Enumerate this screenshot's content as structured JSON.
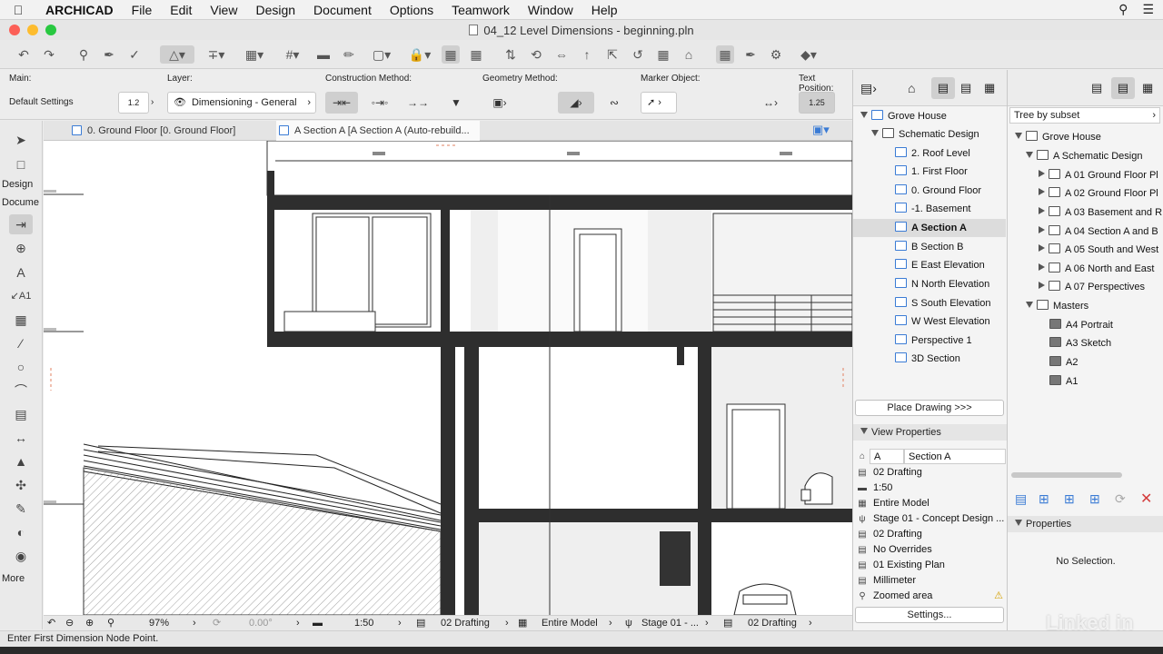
{
  "menubar": {
    "app": "ARCHICAD",
    "items": [
      "File",
      "Edit",
      "View",
      "Design",
      "Document",
      "Options",
      "Teamwork",
      "Window",
      "Help"
    ]
  },
  "window": {
    "title": "04_12 Level Dimensions - beginning.pln"
  },
  "infobox": {
    "main_label": "Main:",
    "main_value": "Default Settings",
    "layer_label": "Layer:",
    "layer_value": "Dimensioning - General",
    "construction_label": "Construction Method:",
    "geometry_label": "Geometry Method:",
    "marker_label": "Marker Object:",
    "text_position_label": "Text Position:",
    "text_position_value": "1.25",
    "dim_icon_text": "1.2"
  },
  "tabs": {
    "plan": "0. Ground Floor [0. Ground Floor]",
    "section": "A Section A [A Section A (Auto-rebuild..."
  },
  "toolbox": {
    "design": "Design",
    "document": "Docume",
    "more": "More"
  },
  "navigator": {
    "root": "Grove House",
    "folder": "Schematic Design",
    "items": [
      "2. Roof Level",
      "1. First Floor",
      "0. Ground Floor",
      "-1. Basement",
      "A Section A",
      "B Section B",
      "E East Elevation",
      "N North Elevation",
      "S South Elevation",
      "W West Elevation",
      "Perspective 1",
      "3D Section"
    ],
    "place_drawing": "Place Drawing >>>",
    "view_properties": "View Properties",
    "id_value": "A",
    "name_value": "Section A",
    "props": [
      "02 Drafting",
      "1:50",
      "Entire Model",
      "Stage 01 - Concept Design ...",
      "02 Drafting",
      "No Overrides",
      "01 Existing Plan",
      "Millimeter",
      "Zoomed area"
    ],
    "settings": "Settings..."
  },
  "organizer": {
    "dropdown": "Tree by subset",
    "root": "Grove House",
    "subset": "A Schematic Design",
    "layouts": [
      "A 01 Ground Floor Pl",
      "A 02 Ground Floor Pl",
      "A 03 Basement and R",
      "A 04 Section A and B",
      "A 05 South and West",
      "A 06 North and East",
      "A 07 Perspectives"
    ],
    "masters_label": "Masters",
    "masters": [
      "A4 Portrait",
      "A3 Sketch",
      "A2",
      "A1"
    ],
    "properties_label": "Properties",
    "no_selection": "No Selection."
  },
  "bottombar": {
    "zoom": "97%",
    "angle": "0.00°",
    "scale": "1:50",
    "layers": "02 Drafting",
    "model": "Entire Model",
    "stage": "Stage 01 - ...",
    "drafting": "02 Drafting"
  },
  "status": "Enter First Dimension Node Point.",
  "watermark": "Linked in"
}
